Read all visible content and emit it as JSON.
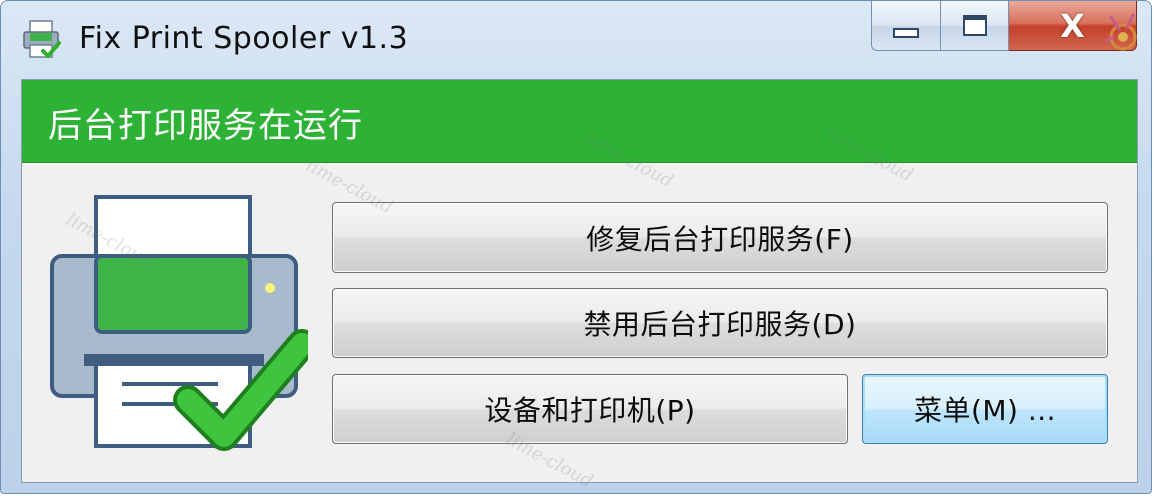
{
  "window": {
    "title": "Fix Print Spooler v1.3",
    "close_symbol": "X",
    "icon": "printer-check-icon"
  },
  "status": {
    "text": "后台打印服务在运行",
    "color": "#2db236"
  },
  "buttons": {
    "fix": "修复后台打印服务(F)",
    "disable": "禁用后台打印服务(D)",
    "devices": "设备和打印机(P)",
    "menu": "菜单(M) ..."
  },
  "illustration": {
    "icon": "printer-ok-icon",
    "accent": "#3fb549",
    "check_color": "#2fb12f"
  },
  "watermark": "lime-cloud"
}
